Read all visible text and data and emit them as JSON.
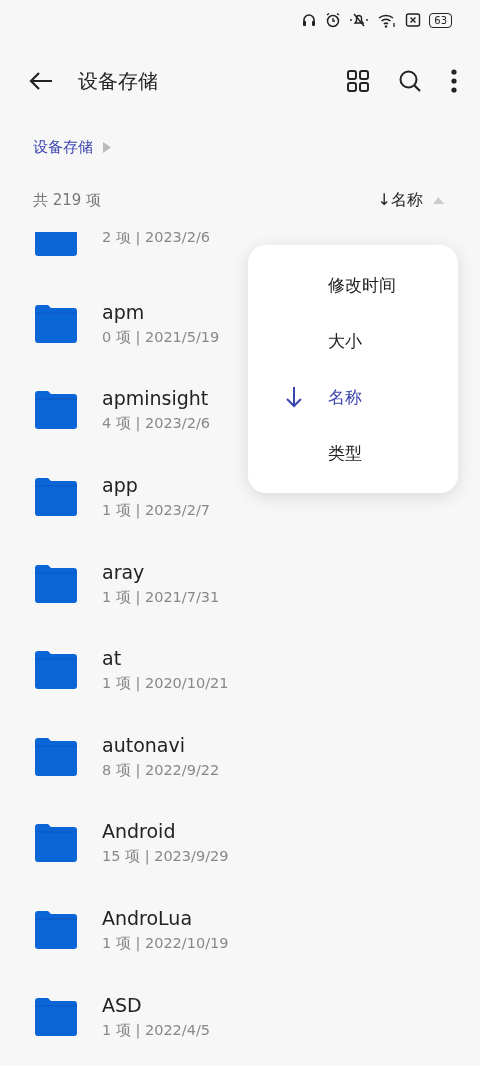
{
  "status_bar": {
    "battery": "63"
  },
  "header": {
    "title": "设备存储"
  },
  "breadcrumb": [
    {
      "label": "设备存储"
    }
  ],
  "list_info": {
    "count": "共 219 项",
    "sort_label": "↓名称"
  },
  "files": [
    {
      "meta": "2 项 | 2023/2/6"
    },
    {
      "name": "apm",
      "meta": "0 项 | 2021/5/19"
    },
    {
      "name": "apminsight",
      "meta": "4 项 | 2023/2/6"
    },
    {
      "name": "app",
      "meta": "1 项 | 2023/2/7"
    },
    {
      "name": "aray",
      "meta": "1 项 | 2021/7/31"
    },
    {
      "name": "at",
      "meta": "1 项 | 2020/10/21"
    },
    {
      "name": "autonavi",
      "meta": "8 项 | 2022/9/22"
    },
    {
      "name": "Android",
      "meta": "15 项 | 2023/9/29"
    },
    {
      "name": "AndroLua",
      "meta": "1 项 | 2022/10/19"
    },
    {
      "name": "ASD",
      "meta": "1 项 | 2022/4/5"
    }
  ],
  "sort_menu": [
    {
      "label": "修改时间",
      "selected": false
    },
    {
      "label": "大小",
      "selected": false
    },
    {
      "label": "名称",
      "selected": true
    },
    {
      "label": "类型",
      "selected": false
    }
  ]
}
